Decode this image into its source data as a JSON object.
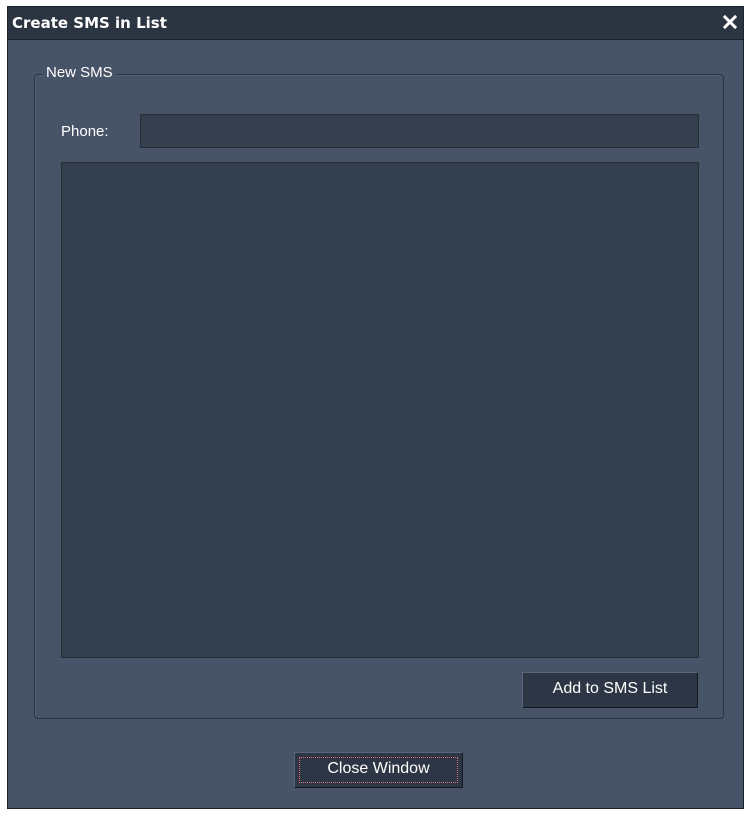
{
  "window": {
    "title": "Create SMS in List",
    "close_icon": "close-icon"
  },
  "group": {
    "legend": "New SMS"
  },
  "phone": {
    "label": "Phone:",
    "value": "",
    "placeholder": ""
  },
  "message": {
    "value": ""
  },
  "buttons": {
    "add_label": "Add to SMS List",
    "close_label": "Close Window"
  },
  "colors": {
    "window_bg": "#475366",
    "titlebar_bg": "#2b3441",
    "field_bg": "#353f4e",
    "button_bg": "#2d3644",
    "text": "#ffffff"
  }
}
